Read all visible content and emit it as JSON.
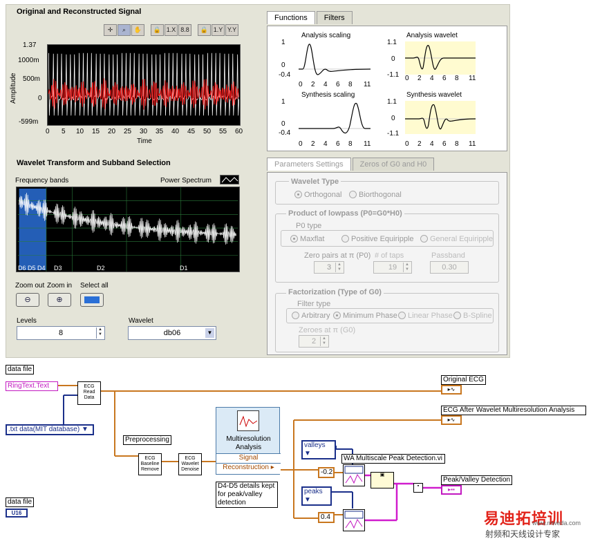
{
  "signal_panel": {
    "title": "Original and Reconstructed Signal",
    "toolbar": [
      "+",
      "zoom",
      "pan",
      "lock",
      "1.X",
      "8.88",
      "lock",
      "1.Y",
      "Y.Y"
    ],
    "y_ticks": [
      "1.37",
      "1000m",
      "500m",
      "0",
      "-599m"
    ],
    "x_ticks": [
      "0",
      "5",
      "10",
      "15",
      "20",
      "25",
      "30",
      "35",
      "40",
      "45",
      "50",
      "55",
      "60"
    ],
    "xlabel": "Time",
    "ylabel": "Amplitude"
  },
  "wavelet_panel": {
    "title": "Wavelet Transform and Subband Selection",
    "freq_label": "Frequency bands",
    "power_label": "Power Spectrum",
    "band_labels": [
      "D6 D5 D4",
      "D3",
      "D2",
      "D1"
    ],
    "zoom_out_label": "Zoom out",
    "zoom_in_label": "Zoom in",
    "select_all_label": "Select all",
    "levels_label": "Levels",
    "levels_value": "8",
    "wavelet_label": "Wavelet",
    "wavelet_value": "db06"
  },
  "functions_panel": {
    "tabs": [
      "Functions",
      "Filters"
    ],
    "charts": [
      {
        "title": "Analysis scaling",
        "yticks": [
          "1",
          "0",
          "-0.4"
        ]
      },
      {
        "title": "Analysis wavelet",
        "yticks": [
          "1.1",
          "0",
          "-1.1"
        ]
      },
      {
        "title": "Synthesis scaling",
        "yticks": [
          "1",
          "0",
          "-0.4"
        ]
      },
      {
        "title": "Synthesis wavelet",
        "yticks": [
          "1.1",
          "0",
          "-1.1"
        ]
      }
    ],
    "xticks": [
      "0",
      "2",
      "4",
      "6",
      "8",
      "11"
    ]
  },
  "params_panel": {
    "tabs": [
      "Parameters Settings",
      "Zeros of G0 and H0"
    ],
    "wavelet_type_title": "Wavelet Type",
    "orthogonal": "Orthogonal",
    "biorthogonal": "Biorthogonal",
    "product_title": "Product of lowpass (P0=G0*H0)",
    "p0_type": "P0 type",
    "maxflat": "Maxflat",
    "positive_equiripple": "Positive Equiripple",
    "general_equiripple": "General Equiripple",
    "zero_pairs_label": "Zero pairs at π (P0)",
    "zero_pairs_value": "3",
    "taps_label": "# of taps",
    "taps_value": "19",
    "passband_label": "Passband",
    "passband_value": "0.30",
    "factorization_title": "Factorization (Type of G0)",
    "filter_type": "Filter type",
    "arbitrary": "Arbitrary",
    "minimum_phase": "Minimum Phase",
    "linear_phase": "Linear Phase",
    "bspline": "B-Spline",
    "zeroes_label": "Zeroes at π (G0)",
    "zeroes_value": "2"
  },
  "diagram": {
    "data_file_label": "data file",
    "ring_text": "RingText.Text",
    "dropdown_text": ".txt data(MIT database)",
    "ecg_read": "ECG Read Data",
    "preprocessing": "Preprocessing",
    "baseline": "ECG Baseline Remove",
    "denoise": "ECG Wavelet Denoise",
    "mra_title": "Multiresolution Analysis",
    "mra_signal": "Signal",
    "mra_recon": "Reconstruction",
    "mra_note": "D4-D5 details kept for peak/valley detection",
    "original_ecg": "Original ECG",
    "ecg_after": "ECG After Wavelet Multiresolution Analysis",
    "valleys": "valleys",
    "peaks": "peaks",
    "neg_thresh": "-0.2",
    "pos_thresh": "0.4",
    "wa_detect": "WA Multiscale Peak Detection.vi",
    "peak_valley": "Peak/Valley Detection",
    "data_file_label2": "data file",
    "u16": "U16"
  },
  "watermark": {
    "text": "易迪拓培训",
    "sub": "射频和天线设计专家",
    "site": "www.mweda.com"
  }
}
